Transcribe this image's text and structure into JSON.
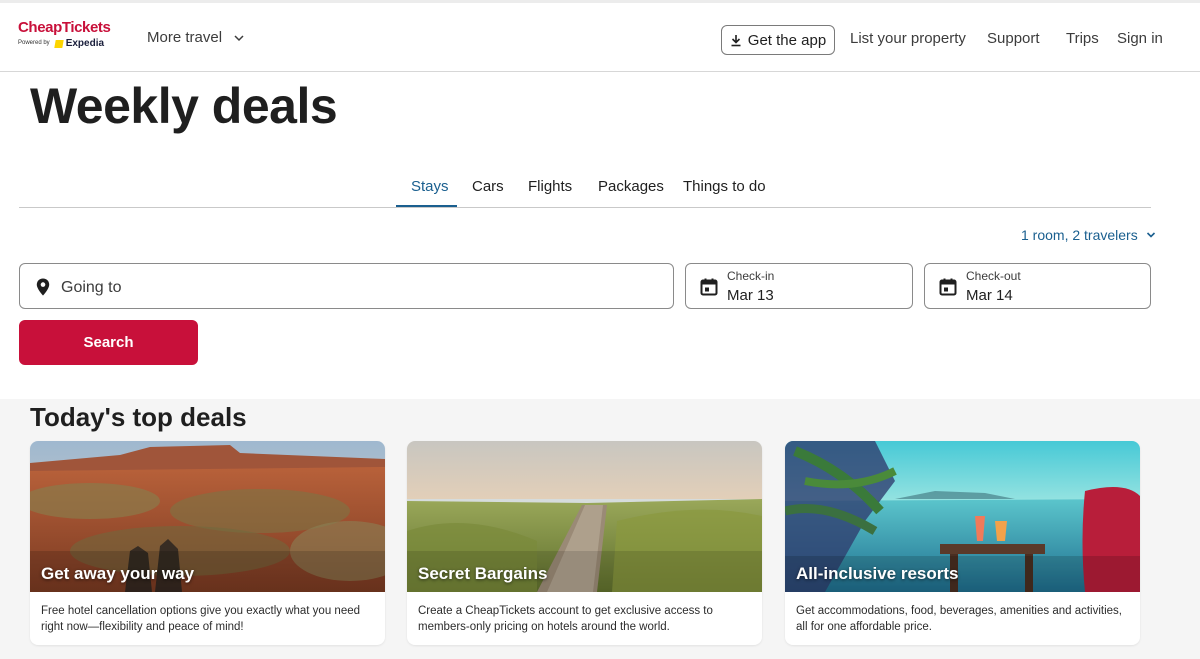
{
  "header": {
    "logo_text": "CheapTickets",
    "logo_powered_by": "Powered by",
    "logo_partner": "Expedia",
    "more_travel": "More travel",
    "get_app": "Get the app",
    "list_property": "List your property",
    "support": "Support",
    "trips": "Trips",
    "sign_in": "Sign in"
  },
  "page_title": "Weekly deals",
  "tabs": [
    {
      "label": "Stays",
      "active": true
    },
    {
      "label": "Cars",
      "active": false
    },
    {
      "label": "Flights",
      "active": false
    },
    {
      "label": "Packages",
      "active": false
    },
    {
      "label": "Things to do",
      "active": false
    }
  ],
  "search": {
    "travelers": "1 room, 2 travelers",
    "going_to_placeholder": "Going to",
    "checkin_label": "Check-in",
    "checkin_value": "Mar 13",
    "checkout_label": "Check-out",
    "checkout_value": "Mar 14",
    "button": "Search"
  },
  "deals": {
    "title": "Today's top deals",
    "cards": [
      {
        "title": "Get away your way",
        "desc": "Free hotel cancellation options give you exactly what you need right now—flexibility and peace of mind!"
      },
      {
        "title": "Secret Bargains",
        "desc": "Create a CheapTickets account to get exclusive access to members-only pricing on hotels around the world."
      },
      {
        "title": "All-inclusive resorts",
        "desc": "Get accommodations, food, beverages, amenities and activities, all for one affordable price."
      }
    ]
  },
  "colors": {
    "brand": "#c8103a",
    "link": "#1a5f8f",
    "deals_background": "#f5f5f5"
  },
  "icons": [
    "chevron-down-icon",
    "download-icon",
    "location-pin-icon",
    "calendar-icon"
  ]
}
